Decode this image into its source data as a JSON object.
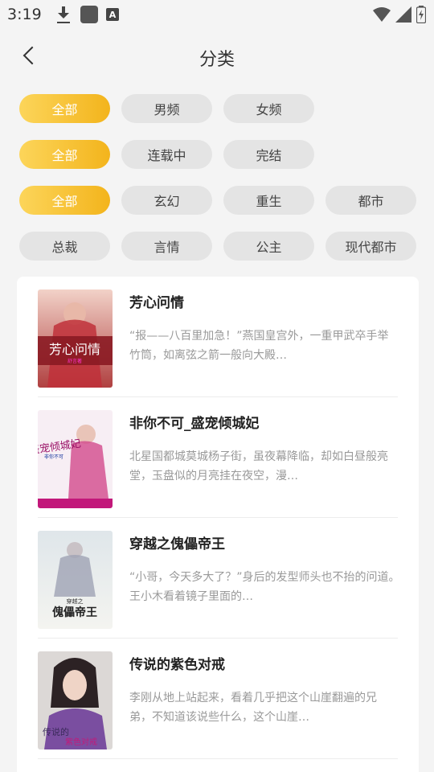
{
  "status": {
    "time": "3:19"
  },
  "header": {
    "title": "分类"
  },
  "filters": {
    "gender": [
      "全部",
      "男频",
      "女频"
    ],
    "status": [
      "全部",
      "连载中",
      "完结"
    ],
    "genre_row1": [
      "全部",
      "玄幻",
      "重生",
      "都市"
    ],
    "genre_row2": [
      "总裁",
      "言情",
      "公主",
      "现代都市"
    ]
  },
  "books": [
    {
      "title": "芳心问情",
      "description": "“报——八百里加急！”燕国皇宫外，一重甲武卒手举竹筒，如离弦之箭一般向大殿…",
      "cover_text": "芳心问情",
      "cover_sub": "舒言著"
    },
    {
      "title": "非你不可_盛宠倾城妃",
      "description": "北星国都城莫城杨子街，虽夜幕降临，却如白昼般亮堂，玉盘似的月亮挂在夜空，漫…",
      "cover_text": "盛宠倾城妃",
      "cover_sub": "非你不可"
    },
    {
      "title": "穿越之傀儡帝王",
      "description": "“小哥，今天多大了？”身后的发型师头也不抬的问道。　　王小木看着镜子里面的…",
      "cover_text": "傀儡帝王",
      "cover_sub": "穿越之"
    },
    {
      "title": "传说的紫色对戒",
      "description": "李刚从地上站起来，看着几乎把这个山崖翻遍的兄弟，不知道该说些什么，这个山崖…",
      "cover_text": "传说的",
      "cover_sub": "紫色对戒"
    }
  ]
}
